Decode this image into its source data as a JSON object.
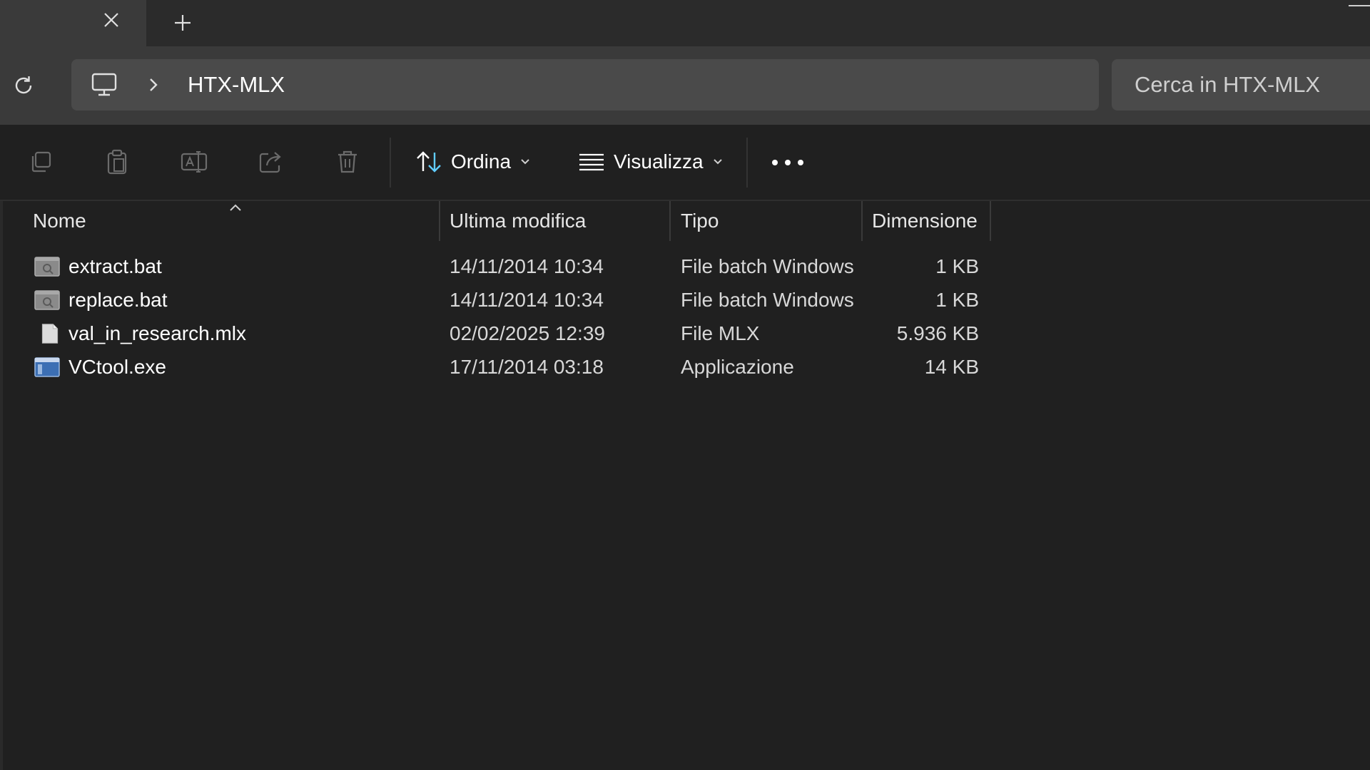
{
  "window": {
    "new_tab_glyph": "+"
  },
  "address": {
    "breadcrumb": "HTX-MLX",
    "search_placeholder": "Cerca in HTX-MLX"
  },
  "toolbar": {
    "sort_label": "Ordina",
    "view_label": "Visualizza"
  },
  "columns": {
    "name": "Nome",
    "modified": "Ultima modifica",
    "type": "Tipo",
    "size": "Dimensione"
  },
  "files": [
    {
      "name": "extract.bat",
      "modified": "14/11/2014 10:34",
      "type": "File batch Windows",
      "size": "1 KB",
      "icon": "batch-file-icon"
    },
    {
      "name": "replace.bat",
      "modified": "14/11/2014 10:34",
      "type": "File batch Windows",
      "size": "1 KB",
      "icon": "batch-file-icon"
    },
    {
      "name": "val_in_research.mlx",
      "modified": "02/02/2025 12:39",
      "type": "File MLX",
      "size": "5.936 KB",
      "icon": "generic-file-icon"
    },
    {
      "name": "VCtool.exe",
      "modified": "17/11/2014 03:18",
      "type": "Applicazione",
      "size": "14 KB",
      "icon": "application-icon"
    }
  ],
  "colors": {
    "background": "#202020",
    "address_bar": "#4a4a4a",
    "tab_active": "#3a3a3a",
    "accent": "#60cdff"
  }
}
